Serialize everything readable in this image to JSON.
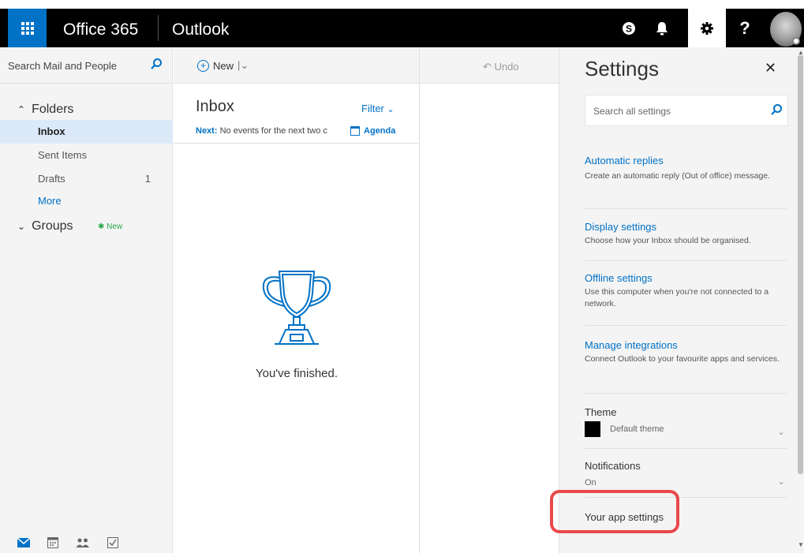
{
  "topbar": {
    "brand": "Office 365",
    "app": "Outlook",
    "skype_icon": "skype-icon",
    "bell_icon": "bell-icon",
    "gear_icon": "gear-icon",
    "help_label": "?"
  },
  "leftnav": {
    "search_placeholder": "Search Mail and People",
    "folders_label": "Folders",
    "items": [
      {
        "label": "Inbox",
        "count": ""
      },
      {
        "label": "Sent Items",
        "count": ""
      },
      {
        "label": "Drafts",
        "count": "1"
      },
      {
        "label": "More",
        "count": ""
      }
    ],
    "groups_label": "Groups",
    "groups_new": "New"
  },
  "commandbar": {
    "new_label": "New",
    "undo_label": "Undo"
  },
  "list": {
    "title": "Inbox",
    "filter_label": "Filter",
    "next_label": "Next:",
    "next_text": "No events for the next two c",
    "agenda_label": "Agenda",
    "empty_text": "You've finished."
  },
  "settings": {
    "title": "Settings",
    "search_placeholder": "Search all settings",
    "links": [
      {
        "title": "Automatic replies",
        "desc": "Create an automatic reply (Out of office) message."
      },
      {
        "title": "Display settings",
        "desc": "Choose how your Inbox should be organised."
      },
      {
        "title": "Offline settings",
        "desc": "Use this computer when you're not connected to a network."
      },
      {
        "title": "Manage integrations",
        "desc": "Connect Outlook to your favourite apps and services."
      }
    ],
    "theme_label": "Theme",
    "theme_value": "Default theme",
    "notifications_label": "Notifications",
    "notifications_value": "On",
    "app_settings_label": "Your app settings"
  },
  "colors": {
    "accent": "#0072c6",
    "highlight": "#e8494b",
    "topbar": "#000000"
  }
}
